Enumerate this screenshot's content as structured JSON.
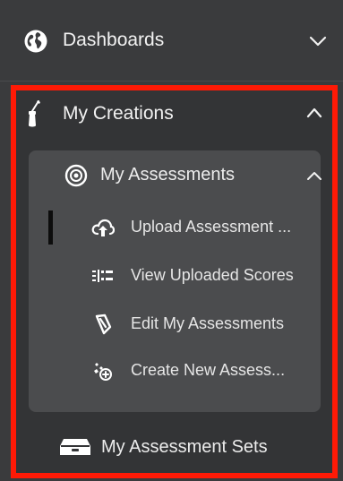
{
  "nav": {
    "dashboards": {
      "label": "Dashboards",
      "icon": "globe-icon",
      "expanded": false
    },
    "my_creations": {
      "label": "My Creations",
      "icon": "brush-icon",
      "expanded": true,
      "my_assessments": {
        "label": "My Assessments",
        "icon": "target-icon",
        "expanded": true,
        "items": [
          {
            "label": "Upload Assessment ...",
            "icon": "cloud-upload-icon",
            "active": true
          },
          {
            "label": "View Uploaded Scores",
            "icon": "list-view-icon",
            "active": false
          },
          {
            "label": "Edit My Assessments",
            "icon": "edit-icon",
            "active": false
          },
          {
            "label": "Create New Assess...",
            "icon": "create-new-icon",
            "active": false
          }
        ]
      },
      "my_assessment_sets": {
        "label": "My Assessment Sets",
        "icon": "tray-icon"
      }
    }
  },
  "colors": {
    "background": "#3a3b3d",
    "highlight_border": "#ff1a06",
    "panel": "#4b4c4e",
    "text": "#ececec",
    "active_indicator": "#0d0d0d"
  }
}
